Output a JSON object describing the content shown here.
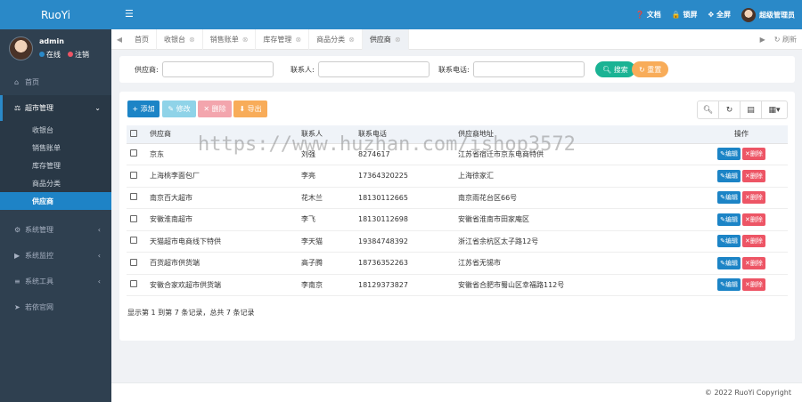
{
  "app": {
    "brand": "RuoYi"
  },
  "user": {
    "name": "admin",
    "online": "在线",
    "logout": "注销"
  },
  "sidebar": {
    "home": "首页",
    "group_open": "超市管理",
    "sub": [
      "收银台",
      "销售账单",
      "库存管理",
      "商品分类",
      "供应商"
    ],
    "items": [
      "系统管理",
      "系统监控",
      "系统工具",
      "若依官网"
    ]
  },
  "topbar": {
    "docs": "文档",
    "lock": "锁屏",
    "fullscreen": "全屏",
    "account": "超级管理员"
  },
  "tabs": {
    "items": [
      "首页",
      "收银台",
      "销售账单",
      "库存管理",
      "商品分类",
      "供应商"
    ],
    "refresh": "刷新"
  },
  "search": {
    "supplier_label": "供应商:",
    "contact_label": "联系人:",
    "phone_label": "联系电话:",
    "search_btn": "搜索",
    "reset_btn": "重置"
  },
  "toolbar": {
    "add": "添加",
    "edit": "修改",
    "delete": "删除",
    "export": "导出"
  },
  "table": {
    "headers": [
      "供应商",
      "联系人",
      "联系电话",
      "供应商地址",
      "操作"
    ],
    "rows": [
      [
        "京东",
        "刘强",
        "8274617",
        "江苏省宿迁市京东电商特供"
      ],
      [
        "上海桃李面包厂",
        "李亮",
        "17364320225",
        "上海徐家汇"
      ],
      [
        "南京百大超市",
        "花木兰",
        "18130112665",
        "南京雨花台区66号"
      ],
      [
        "安徽淮南超市",
        "李飞",
        "18130112698",
        "安徽省淮南市田家庵区"
      ],
      [
        "天猫超市电商线下特供",
        "李天猫",
        "19384748392",
        "浙江省余杭区太子路12号"
      ],
      [
        "百货超市供货端",
        "高子腾",
        "18736352263",
        "江苏省无锡市"
      ],
      [
        "安徽合家欢超市供货端",
        "李南京",
        "18129373827",
        "安徽省合肥市蜀山区幸福路112号"
      ]
    ],
    "edit_label": "编辑",
    "delete_label": "删除"
  },
  "pager": "显示第 1 到第 7 条记录，总共 7 条记录",
  "watermark": "https://www.huzhan.com/ishop3572",
  "footer": "© 2022 RuoYi Copyright"
}
